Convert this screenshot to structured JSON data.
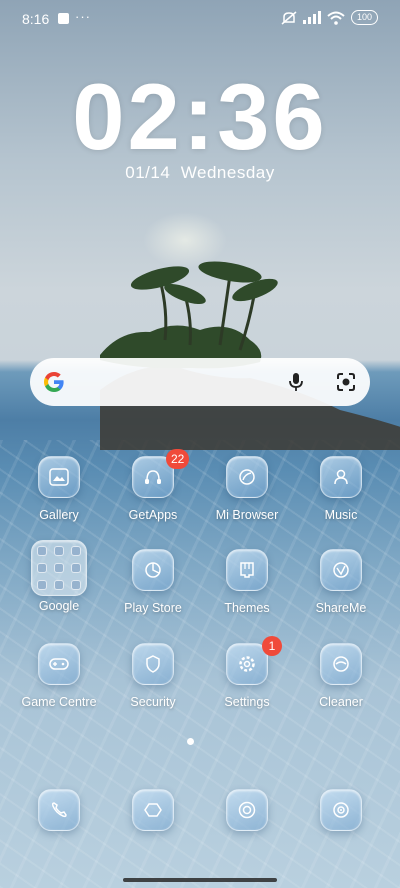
{
  "status_bar": {
    "time": "8:16",
    "dots": "···",
    "battery": "100"
  },
  "lock": {
    "time": "02:36",
    "date": "01/14",
    "weekday": "Wednesday"
  },
  "search": {
    "logo": "google-logo",
    "mic": "mic-icon",
    "lens": "lens-icon"
  },
  "apps": [
    {
      "label": "Gallery",
      "icon": "gallery-icon"
    },
    {
      "label": "GetApps",
      "icon": "getapps-icon",
      "badge": "22"
    },
    {
      "label": "Mi Browser",
      "icon": "browser-icon"
    },
    {
      "label": "Music",
      "icon": "music-icon"
    },
    {
      "label": "Google",
      "icon": "folder-icon"
    },
    {
      "label": "Play Store",
      "icon": "play-store-icon"
    },
    {
      "label": "Themes",
      "icon": "themes-icon"
    },
    {
      "label": "ShareMe",
      "icon": "shareme-icon"
    },
    {
      "label": "Game Centre",
      "icon": "game-centre-icon"
    },
    {
      "label": "Security",
      "icon": "security-icon"
    },
    {
      "label": "Settings",
      "icon": "settings-icon",
      "badge": "1"
    },
    {
      "label": "Cleaner",
      "icon": "cleaner-icon"
    }
  ],
  "dock": [
    {
      "icon": "phone-icon"
    },
    {
      "icon": "messages-icon"
    },
    {
      "icon": "chrome-icon"
    },
    {
      "icon": "camera-icon"
    }
  ],
  "page_indicator": {
    "pages": 1,
    "current": 1
  }
}
